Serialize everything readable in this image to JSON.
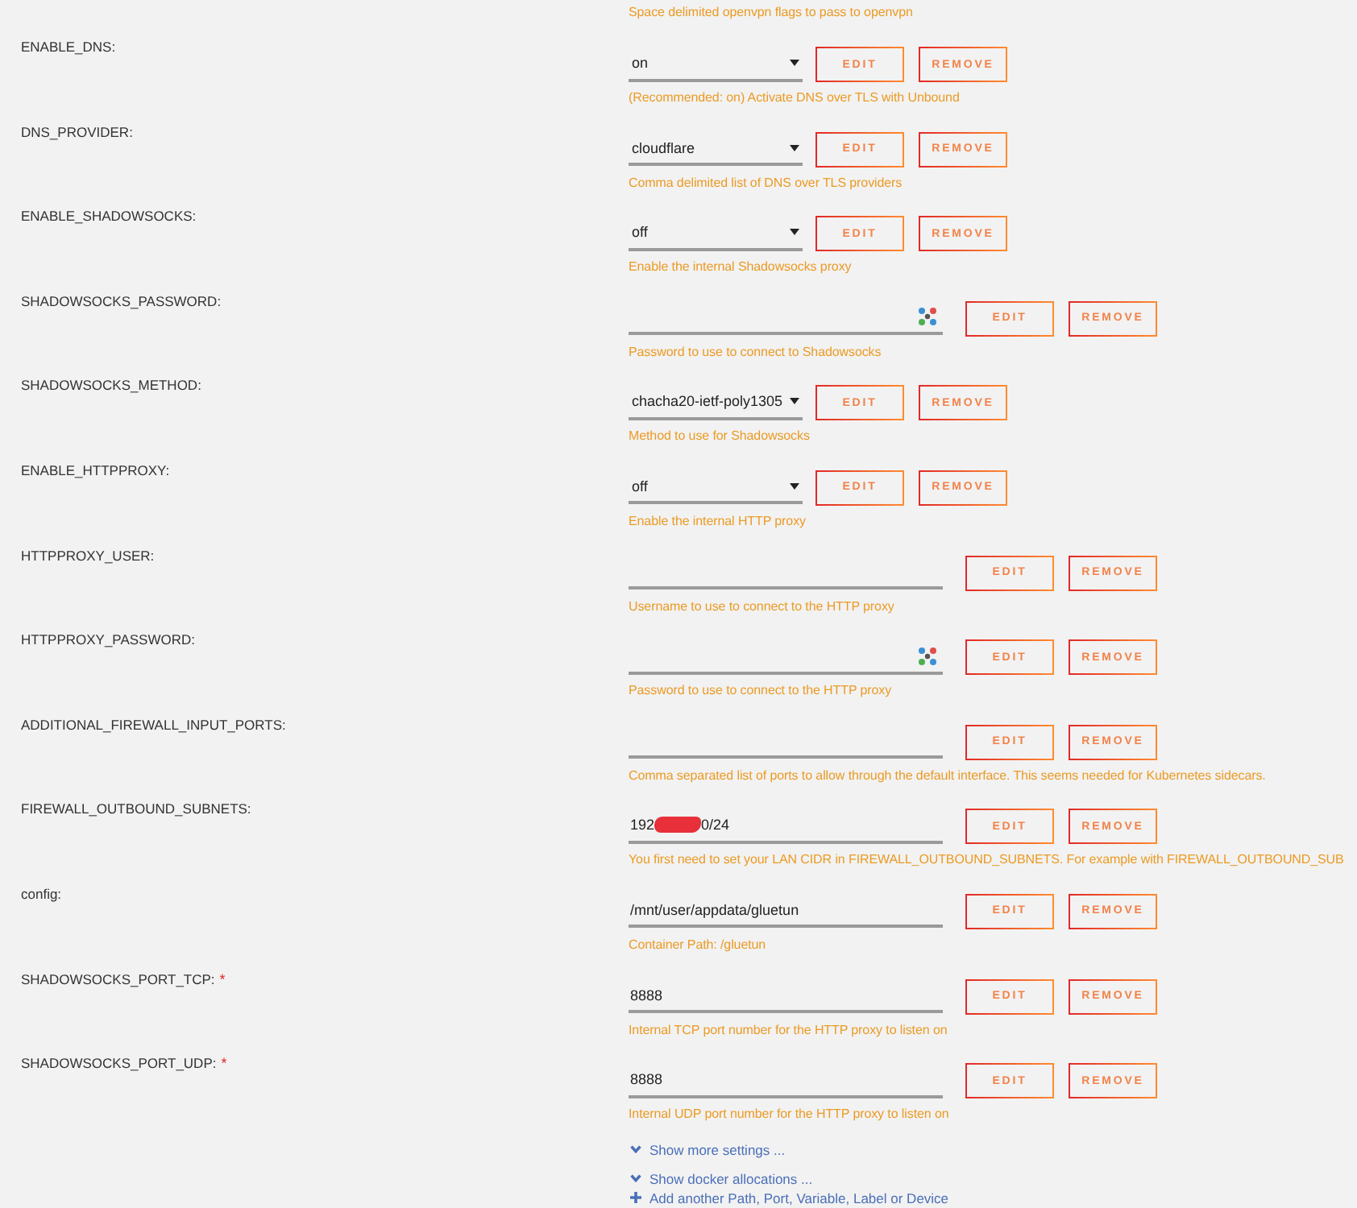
{
  "top_description": "Space delimited openvpn flags to pass to openvpn",
  "settings": [
    {
      "label": "ENABLE_DNS:",
      "kind": "select",
      "value": "on",
      "buttons": [
        "EDIT",
        "REMOVE"
      ],
      "description": "(Recommended: on) Activate DNS over TLS with Unbound"
    },
    {
      "label": "DNS_PROVIDER:",
      "kind": "select",
      "value": "cloudflare",
      "buttons": [
        "EDIT",
        "REMOVE"
      ],
      "description": "Comma delimited list of DNS over TLS providers"
    },
    {
      "label": "ENABLE_SHADOWSOCKS:",
      "kind": "select",
      "value": "off",
      "buttons": [
        "EDIT",
        "REMOVE"
      ],
      "description": "Enable the internal Shadowsocks proxy"
    },
    {
      "label": "SHADOWSOCKS_PASSWORD:",
      "kind": "password",
      "buttons": [
        "EDIT",
        "REMOVE"
      ],
      "description": "Password to use to connect to Shadowsocks"
    },
    {
      "label": "SHADOWSOCKS_METHOD:",
      "kind": "select",
      "value": "chacha20-ietf-poly1305",
      "buttons": [
        "EDIT",
        "REMOVE"
      ],
      "description": "Method to use for Shadowsocks"
    },
    {
      "label": "ENABLE_HTTPPROXY:",
      "kind": "select",
      "value": "off",
      "buttons": [
        "EDIT",
        "REMOVE"
      ],
      "description": "Enable the internal HTTP proxy"
    },
    {
      "label": "HTTPPROXY_USER:",
      "kind": "text",
      "buttons": [
        "EDIT",
        "REMOVE"
      ],
      "description": "Username to use to connect to the HTTP proxy"
    },
    {
      "label": "HTTPPROXY_PASSWORD:",
      "kind": "password",
      "buttons": [
        "EDIT",
        "REMOVE"
      ],
      "description": "Password to use to connect to the HTTP proxy"
    },
    {
      "label": "ADDITIONAL_FIREWALL_INPUT_PORTS:",
      "kind": "text",
      "buttons": [
        "EDIT",
        "REMOVE"
      ],
      "description": "Comma separated list of ports to allow through the default interface. This seems needed for Kubernetes sidecars."
    },
    {
      "label": "FIREWALL_OUTBOUND_SUBNETS:",
      "kind": "text",
      "value": "192",
      "redacted": true,
      "value_end": "0/24",
      "buttons": [
        "EDIT",
        "REMOVE"
      ],
      "description": "You first need to set your LAN CIDR in FIREWALL_OUTBOUND_SUBNETS. For example with FIREWALL_OUTBOUND_SUB"
    },
    {
      "label": "config:",
      "kind": "text",
      "value": "/mnt/user/appdata/gluetun",
      "buttons": [
        "EDIT",
        "REMOVE"
      ],
      "description": "Container Path: /gluetun"
    },
    {
      "label": "SHADOWSOCKS_PORT_TCP:",
      "required_mark": "*",
      "kind": "text",
      "value": "8888",
      "buttons": [
        "EDIT",
        "REMOVE"
      ],
      "description": "Internal TCP port number for the HTTP proxy to listen on"
    },
    {
      "label": "SHADOWSOCKS_PORT_UDP:",
      "required_mark": "*",
      "kind": "text",
      "value": "8888",
      "buttons": [
        "EDIT",
        "REMOVE"
      ],
      "description": "Internal UDP port number for the HTTP proxy to listen on"
    }
  ],
  "links": [
    {
      "kind": "expand",
      "text": "Show more settings ..."
    },
    {
      "kind": "expand",
      "text": "Show docker allocations ..."
    },
    {
      "kind": "add",
      "text": "Add another Path, Port, Variable, Label or Device"
    }
  ]
}
